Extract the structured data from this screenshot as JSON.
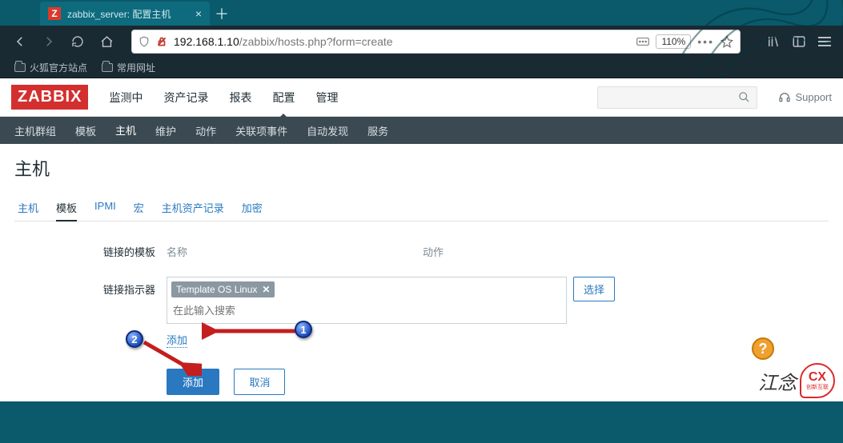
{
  "browser": {
    "tab_title": "zabbix_server: 配置主机",
    "url_host": "192.168.1.10",
    "url_path": "/zabbix/hosts.php?form=create",
    "zoom": "110%",
    "bookmarks": [
      "火狐官方站点",
      "常用网址"
    ]
  },
  "zabbix": {
    "logo": "ZABBIX",
    "top_nav": [
      "监测中",
      "资产记录",
      "报表",
      "配置",
      "管理"
    ],
    "top_nav_active": 3,
    "support": "Support",
    "sub_nav": [
      "主机群组",
      "模板",
      "主机",
      "维护",
      "动作",
      "关联项事件",
      "自动发现",
      "服务"
    ],
    "sub_nav_active": 2,
    "page_title": "主机",
    "form_tabs": [
      "主机",
      "模板",
      "IPMI",
      "宏",
      "主机资产记录",
      "加密"
    ],
    "form_tab_active": 1,
    "linked_templates": {
      "label": "链接的模板",
      "th_name": "名称",
      "th_action": "动作"
    },
    "link_selector": {
      "label": "链接指示器",
      "tag": "Template OS Linux",
      "placeholder": "在此输入搜索",
      "select_btn": "选择",
      "inline_add": "添加"
    },
    "buttons": {
      "submit": "添加",
      "cancel": "取消"
    }
  },
  "annotations": {
    "b1": "1",
    "b2": "2"
  },
  "watermark": {
    "text": "江念",
    "bubble_top": "CX",
    "bubble_bottom": "创新互联"
  }
}
